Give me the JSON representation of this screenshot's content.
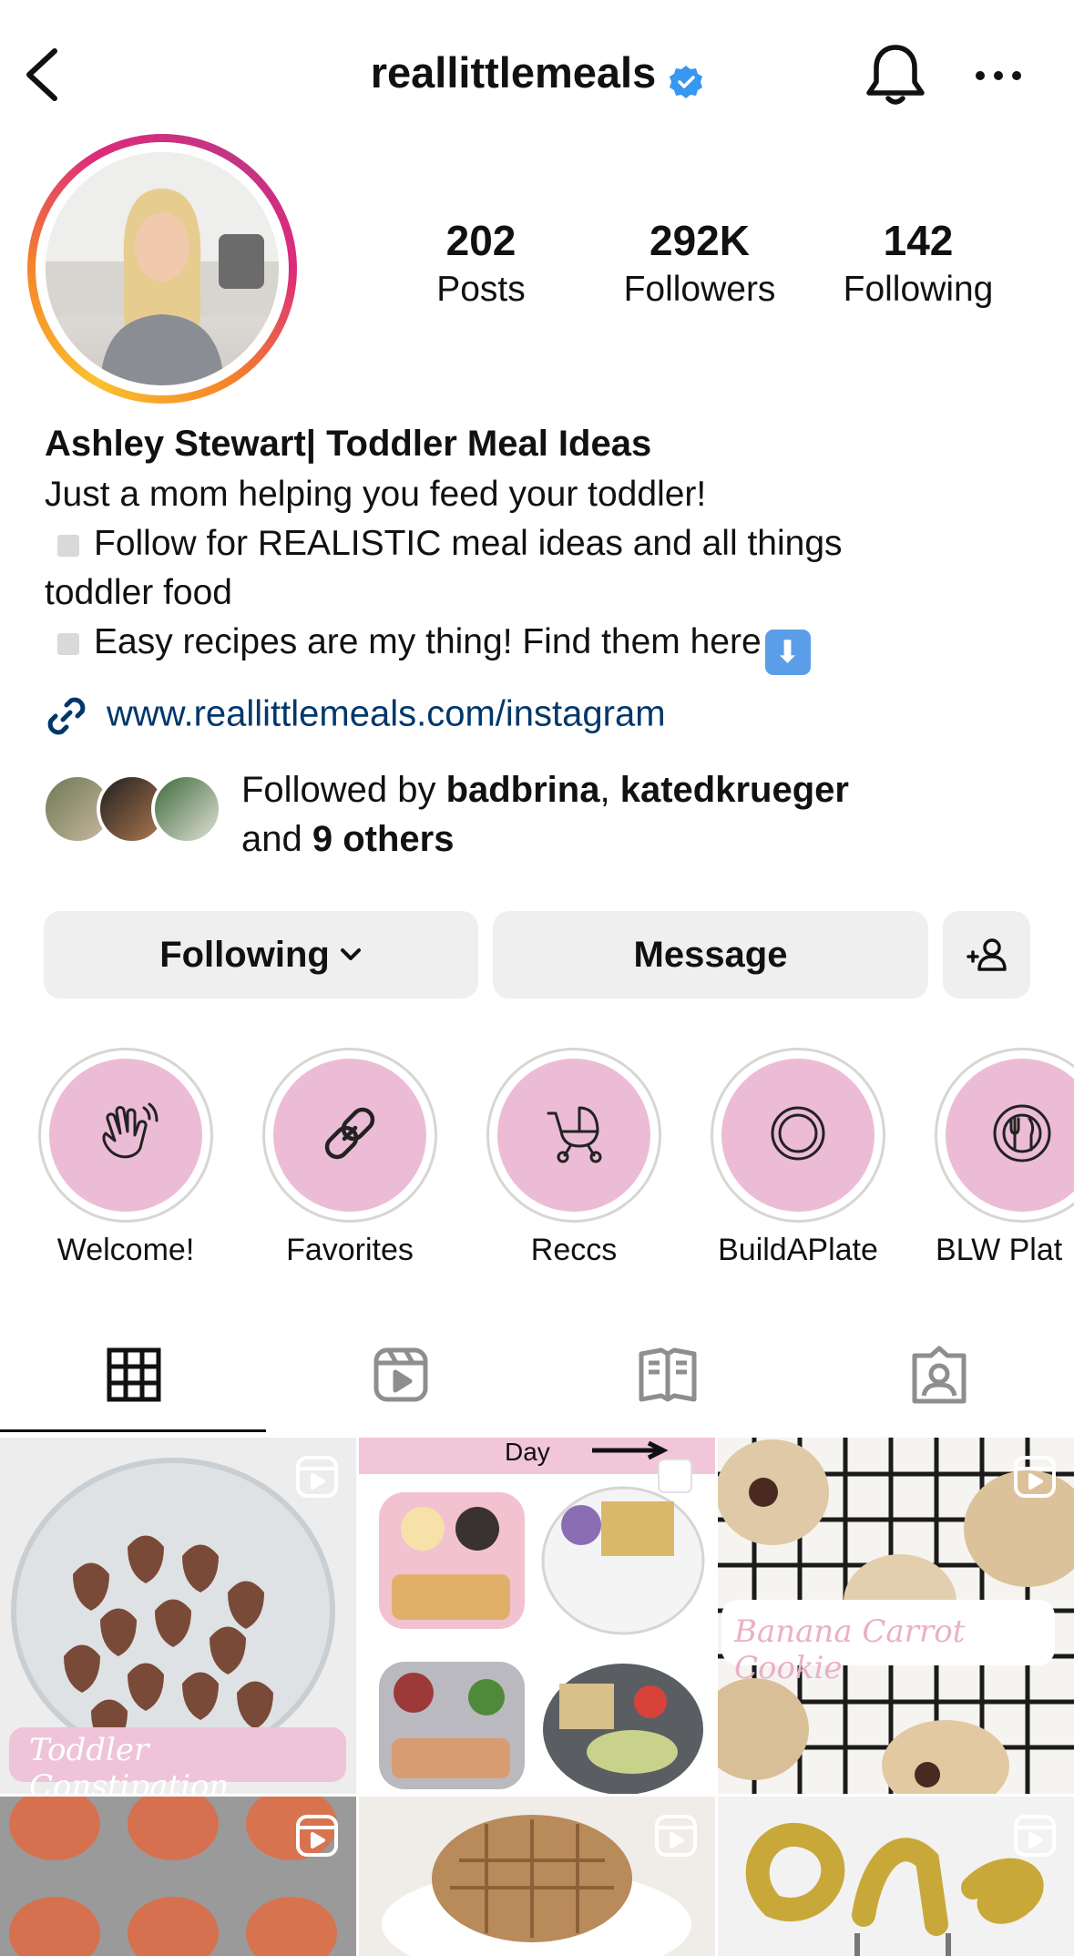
{
  "header": {
    "username": "reallittlemeals"
  },
  "stats": [
    {
      "value": "202",
      "label": "Posts"
    },
    {
      "value": "292K",
      "label": "Followers"
    },
    {
      "value": "142",
      "label": "Following"
    }
  ],
  "bio": {
    "name": "Ashley Stewart| Toddler Meal Ideas",
    "line1": "Just a mom helping you feed your toddler!",
    "line2": "Follow for REALISTIC meal ideas and all things",
    "line3": "toddler food",
    "line4": "Easy recipes are my thing! Find them here",
    "link": "www.reallittlemeals.com/instagram"
  },
  "followed_by": {
    "prefix": "Followed by ",
    "user1": "badbrina",
    "sep": ", ",
    "user2": "katedkrueger",
    "and": "and ",
    "others": "9 others"
  },
  "buttons": {
    "following": "Following",
    "message": "Message"
  },
  "highlights": [
    {
      "label": "Welcome!",
      "icon": "waving-hand-icon"
    },
    {
      "label": "Favorites",
      "icon": "link-chain-icon"
    },
    {
      "label": "Reccs",
      "icon": "stroller-icon"
    },
    {
      "label": "BuildAPlate",
      "icon": "plate-icon"
    },
    {
      "label": "BLW Plat",
      "icon": "plate-fork-knife-icon"
    }
  ],
  "grid": {
    "post1_caption": "Toddler Constipation",
    "post2_caption": "Day",
    "post3_caption": "Banana Carrot Cookie"
  },
  "colors": {
    "link": "#00376b",
    "highlight_fill": "#ecbcd6",
    "button_bg": "#efefef",
    "verified": "#3897f0"
  }
}
